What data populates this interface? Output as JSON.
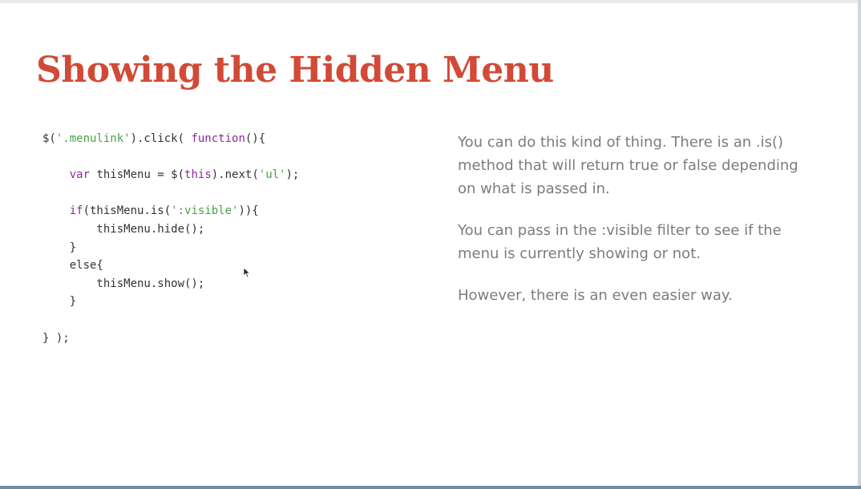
{
  "slide": {
    "title": "Showing the Hidden Menu"
  },
  "code": {
    "lines": [
      [
        {
          "t": "$(",
          "k": "plain"
        },
        {
          "t": "'.menulink'",
          "k": "str"
        },
        {
          "t": ").click( ",
          "k": "plain"
        },
        {
          "t": "function",
          "k": "kw"
        },
        {
          "t": "(){",
          "k": "plain"
        }
      ],
      [],
      [
        {
          "t": "    ",
          "k": "plain"
        },
        {
          "t": "var",
          "k": "kw"
        },
        {
          "t": " thisMenu = $(",
          "k": "plain"
        },
        {
          "t": "this",
          "k": "kw"
        },
        {
          "t": ").next(",
          "k": "plain"
        },
        {
          "t": "'ul'",
          "k": "str"
        },
        {
          "t": ");",
          "k": "plain"
        }
      ],
      [],
      [
        {
          "t": "    ",
          "k": "plain"
        },
        {
          "t": "if",
          "k": "kw"
        },
        {
          "t": "(thisMenu.is(",
          "k": "plain"
        },
        {
          "t": "':visible'",
          "k": "str"
        },
        {
          "t": ")){",
          "k": "plain"
        }
      ],
      [
        {
          "t": "        thisMenu.hide();",
          "k": "plain"
        }
      ],
      [
        {
          "t": "    }",
          "k": "plain"
        }
      ],
      [
        {
          "t": "    else{",
          "k": "plain"
        }
      ],
      [
        {
          "t": "        thisMenu.show();",
          "k": "plain"
        }
      ],
      [
        {
          "t": "    }",
          "k": "plain"
        }
      ],
      [],
      [
        {
          "t": "} );",
          "k": "plain"
        }
      ]
    ]
  },
  "notes": {
    "paragraph_1": "You can do this kind of thing. There is an .is() method that will return true or false depending on what is passed in.",
    "paragraph_2": "You can pass in the :visible filter to see if the menu is currently showing or not.",
    "paragraph_3": "However, there is an even easier way."
  },
  "colors": {
    "title": "#d24a37",
    "code_string": "#4aa04a",
    "code_keyword": "#8b2a9a",
    "code_plain": "#333333",
    "notes_text": "#7c7c7c"
  },
  "icons": {
    "cursor": "mouse-pointer-icon"
  }
}
